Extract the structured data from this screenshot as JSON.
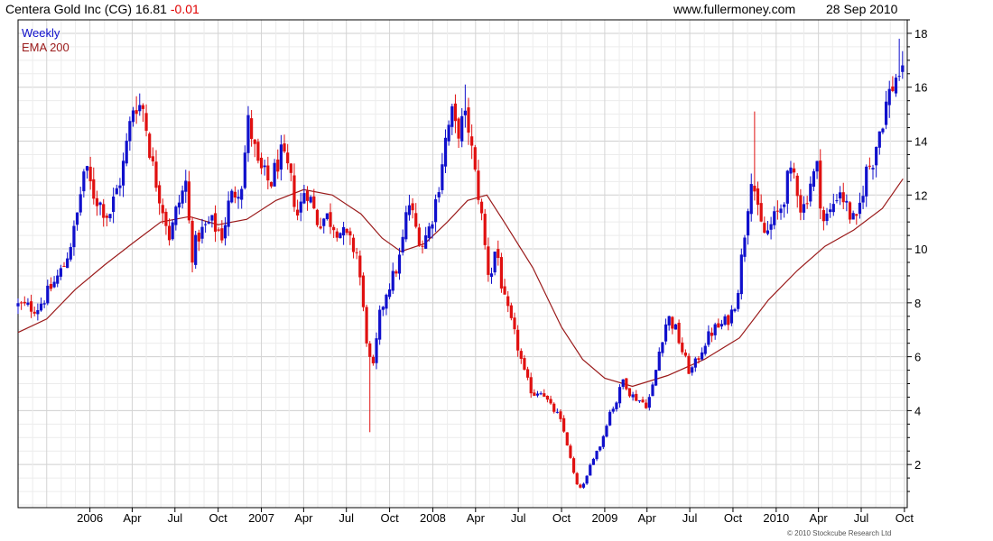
{
  "header": {
    "title": "Centera Gold Inc (CG) 16.81",
    "change": "-0.01",
    "site": "www.fullermoney.com",
    "date": "28 Sep 2010"
  },
  "copyright": "© 2010 Stockcube Research Ltd",
  "colors": {
    "up": "#1010cc",
    "down": "#e01010",
    "ema": "#9a1a1a",
    "grid": "#dddddd",
    "frame": "#000000"
  },
  "chart_data": {
    "type": "candlestick",
    "legend": [
      {
        "label": "Weekly",
        "color": "#1010cc"
      },
      {
        "label": "EMA 200",
        "color": "#9a1a1a"
      }
    ],
    "legend_placement": "top-left",
    "y_axis": {
      "side": "right",
      "min": 0.4,
      "max": 18.5,
      "ticks": [
        2,
        4,
        6,
        8,
        10,
        12,
        14,
        16,
        18
      ]
    },
    "x_axis": {
      "start": "2005-08-01",
      "end": "2010-10-07",
      "ticks": [
        {
          "date": "2006-01-01",
          "label": "2006"
        },
        {
          "date": "2006-04-01",
          "label": "Apr"
        },
        {
          "date": "2006-07-01",
          "label": "Jul"
        },
        {
          "date": "2006-10-01",
          "label": "Oct"
        },
        {
          "date": "2007-01-01",
          "label": "2007"
        },
        {
          "date": "2007-04-01",
          "label": "Apr"
        },
        {
          "date": "2007-07-01",
          "label": "Jul"
        },
        {
          "date": "2007-10-01",
          "label": "Oct"
        },
        {
          "date": "2008-01-01",
          "label": "2008"
        },
        {
          "date": "2008-04-01",
          "label": "Apr"
        },
        {
          "date": "2008-07-01",
          "label": "Jul"
        },
        {
          "date": "2008-10-01",
          "label": "Oct"
        },
        {
          "date": "2009-01-01",
          "label": "2009"
        },
        {
          "date": "2009-04-01",
          "label": "Apr"
        },
        {
          "date": "2009-07-01",
          "label": "Jul"
        },
        {
          "date": "2009-10-01",
          "label": "Oct"
        },
        {
          "date": "2010-01-01",
          "label": "2010"
        },
        {
          "date": "2010-04-01",
          "label": "Apr"
        },
        {
          "date": "2010-07-01",
          "label": "Jul"
        },
        {
          "date": "2010-10-01",
          "label": "Oct"
        }
      ]
    },
    "grid": true,
    "close_path": [
      [
        "2005-08-01",
        7.9
      ],
      [
        "2005-09-10",
        7.8
      ],
      [
        "2005-10-01",
        8.3
      ],
      [
        "2005-11-05",
        9.3
      ],
      [
        "2005-12-01",
        10.8
      ],
      [
        "2005-12-20",
        13.0
      ],
      [
        "2006-01-10",
        12.0
      ],
      [
        "2006-02-10",
        11.2
      ],
      [
        "2006-03-10",
        12.8
      ],
      [
        "2006-04-05",
        15.5
      ],
      [
        "2006-04-25",
        15.2
      ],
      [
        "2006-05-15",
        13.0
      ],
      [
        "2006-06-10",
        11.2
      ],
      [
        "2006-06-20",
        10.4
      ],
      [
        "2006-07-05",
        11.5
      ],
      [
        "2006-07-25",
        12.5
      ],
      [
        "2006-08-05",
        9.7
      ],
      [
        "2006-08-20",
        10.5
      ],
      [
        "2006-09-15",
        11.0
      ],
      [
        "2006-10-10",
        10.5
      ],
      [
        "2006-10-25",
        11.8
      ],
      [
        "2006-11-20",
        12.5
      ],
      [
        "2006-12-05",
        14.8
      ],
      [
        "2006-12-25",
        13.0
      ],
      [
        "2007-01-20",
        12.4
      ],
      [
        "2007-02-10",
        13.5
      ],
      [
        "2007-03-01",
        12.8
      ],
      [
        "2007-03-20",
        11.2
      ],
      [
        "2007-04-05",
        12.4
      ],
      [
        "2007-05-01",
        11.0
      ],
      [
        "2007-05-20",
        11.2
      ],
      [
        "2007-06-10",
        10.8
      ],
      [
        "2007-07-01",
        10.4
      ],
      [
        "2007-07-25",
        9.8
      ],
      [
        "2007-08-10",
        7.0
      ],
      [
        "2007-08-25",
        5.3
      ],
      [
        "2007-09-10",
        7.5
      ],
      [
        "2007-09-25",
        8.5
      ],
      [
        "2007-10-10",
        9.0
      ],
      [
        "2007-10-25",
        9.8
      ],
      [
        "2007-11-10",
        11.8
      ],
      [
        "2007-11-25",
        10.8
      ],
      [
        "2007-12-10",
        10.2
      ],
      [
        "2007-12-25",
        10.8
      ],
      [
        "2008-01-10",
        12.0
      ],
      [
        "2008-01-25",
        13.8
      ],
      [
        "2008-02-10",
        15.0
      ],
      [
        "2008-02-20",
        14.3
      ],
      [
        "2008-03-01",
        14.6
      ],
      [
        "2008-03-15",
        14.8
      ],
      [
        "2008-03-30",
        12.8
      ],
      [
        "2008-04-10",
        11.8
      ],
      [
        "2008-04-20",
        10.2
      ],
      [
        "2008-05-01",
        8.8
      ],
      [
        "2008-05-15",
        10.2
      ],
      [
        "2008-05-30",
        8.2
      ],
      [
        "2008-06-15",
        7.3
      ],
      [
        "2008-07-01",
        6.3
      ],
      [
        "2008-07-15",
        5.3
      ],
      [
        "2008-08-01",
        4.6
      ],
      [
        "2008-08-20",
        4.8
      ],
      [
        "2008-09-05",
        4.2
      ],
      [
        "2008-09-25",
        3.8
      ],
      [
        "2008-10-10",
        3.0
      ],
      [
        "2008-10-25",
        1.8
      ],
      [
        "2008-11-05",
        1.1
      ],
      [
        "2008-11-20",
        1.3
      ],
      [
        "2008-12-05",
        2.2
      ],
      [
        "2008-12-25",
        2.8
      ],
      [
        "2009-01-10",
        3.9
      ],
      [
        "2009-01-25",
        4.3
      ],
      [
        "2009-02-10",
        5.2
      ],
      [
        "2009-02-25",
        4.6
      ],
      [
        "2009-03-15",
        4.4
      ],
      [
        "2009-04-01",
        4.2
      ],
      [
        "2009-04-15",
        5.0
      ],
      [
        "2009-04-30",
        6.5
      ],
      [
        "2009-05-15",
        7.5
      ],
      [
        "2009-06-01",
        7.0
      ],
      [
        "2009-06-15",
        6.2
      ],
      [
        "2009-07-01",
        5.4
      ],
      [
        "2009-07-15",
        5.8
      ],
      [
        "2009-08-01",
        6.5
      ],
      [
        "2009-08-20",
        7.0
      ],
      [
        "2009-09-10",
        7.2
      ],
      [
        "2009-09-25",
        7.5
      ],
      [
        "2009-10-10",
        8.3
      ],
      [
        "2009-10-25",
        10.5
      ],
      [
        "2009-11-10",
        13.0
      ],
      [
        "2009-11-25",
        11.0
      ],
      [
        "2009-12-10",
        10.5
      ],
      [
        "2009-12-25",
        11.0
      ],
      [
        "2010-01-10",
        11.5
      ],
      [
        "2010-01-25",
        12.5
      ],
      [
        "2010-02-10",
        12.8
      ],
      [
        "2010-02-25",
        11.3
      ],
      [
        "2010-03-15",
        12.5
      ],
      [
        "2010-03-30",
        13.0
      ],
      [
        "2010-04-10",
        11.0
      ],
      [
        "2010-04-25",
        11.3
      ],
      [
        "2010-05-15",
        12.3
      ],
      [
        "2010-06-01",
        11.5
      ],
      [
        "2010-06-20",
        10.8
      ],
      [
        "2010-07-10",
        12.8
      ],
      [
        "2010-07-25",
        13.3
      ],
      [
        "2010-08-10",
        14.5
      ],
      [
        "2010-08-25",
        15.5
      ],
      [
        "2010-09-10",
        16.3
      ],
      [
        "2010-09-28",
        16.81
      ]
    ],
    "ema_200": [
      [
        "2005-08-01",
        6.9
      ],
      [
        "2005-10-01",
        7.4
      ],
      [
        "2005-12-01",
        8.5
      ],
      [
        "2006-02-01",
        9.4
      ],
      [
        "2006-04-01",
        10.2
      ],
      [
        "2006-06-01",
        11.0
      ],
      [
        "2006-08-01",
        11.2
      ],
      [
        "2006-10-01",
        10.9
      ],
      [
        "2006-12-01",
        11.1
      ],
      [
        "2007-02-01",
        11.8
      ],
      [
        "2007-04-01",
        12.2
      ],
      [
        "2007-06-01",
        12.0
      ],
      [
        "2007-08-01",
        11.3
      ],
      [
        "2007-09-15",
        10.4
      ],
      [
        "2007-10-25",
        9.9
      ],
      [
        "2007-12-15",
        10.2
      ],
      [
        "2008-02-01",
        11.0
      ],
      [
        "2008-03-15",
        11.8
      ],
      [
        "2008-04-25",
        12.0
      ],
      [
        "2008-06-01",
        11.0
      ],
      [
        "2008-08-01",
        9.3
      ],
      [
        "2008-10-01",
        7.1
      ],
      [
        "2008-11-15",
        5.9
      ],
      [
        "2009-01-01",
        5.2
      ],
      [
        "2009-03-01",
        4.9
      ],
      [
        "2009-05-15",
        5.3
      ],
      [
        "2009-08-01",
        5.9
      ],
      [
        "2009-10-15",
        6.7
      ],
      [
        "2009-12-15",
        8.1
      ],
      [
        "2010-02-15",
        9.2
      ],
      [
        "2010-04-15",
        10.1
      ],
      [
        "2010-06-15",
        10.7
      ],
      [
        "2010-08-15",
        11.5
      ],
      [
        "2010-09-28",
        12.6
      ]
    ],
    "spikes": [
      {
        "date": "2007-08-20",
        "low": 3.2
      },
      {
        "date": "2008-03-10",
        "high": 16.1
      },
      {
        "date": "2009-11-15",
        "high": 15.1
      },
      {
        "date": "2010-09-20",
        "high": 17.8
      }
    ]
  }
}
